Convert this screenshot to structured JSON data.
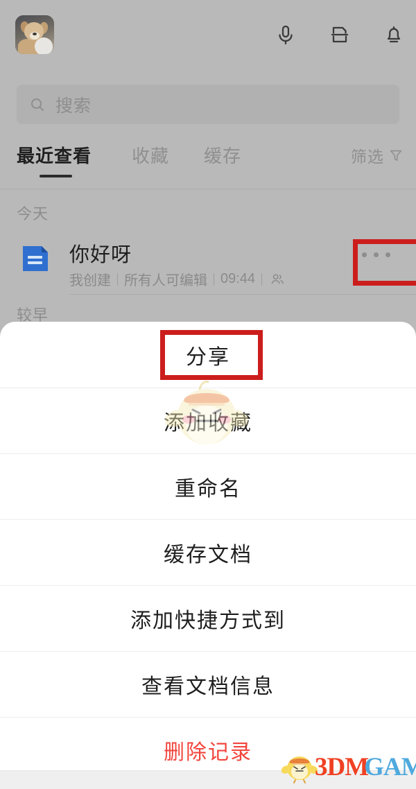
{
  "topbar": {
    "avatar_alt": "用户头像",
    "icons": [
      {
        "name": "microphone-icon",
        "label": "语音"
      },
      {
        "name": "scan-icon",
        "label": "扫一扫"
      },
      {
        "name": "bell-icon",
        "label": "通知"
      }
    ]
  },
  "search": {
    "placeholder": "搜索",
    "value": "",
    "icon": "search-icon"
  },
  "tabs": [
    {
      "label": "最近查看",
      "active": true
    },
    {
      "label": "收藏",
      "active": false
    },
    {
      "label": "缓存",
      "active": false
    }
  ],
  "filter": {
    "label": "筛选",
    "icon": "funnel-icon"
  },
  "sections": {
    "today": "今天",
    "earlier": "较早"
  },
  "document": {
    "title": "你好呀",
    "owner": "我创建",
    "permission": "所有人可编辑",
    "time": "09:44",
    "collaborators_icon": "group-icon",
    "more_label": "更多",
    "file_icon": "doc-icon"
  },
  "action_sheet": {
    "items": [
      {
        "label": "分享",
        "danger": false,
        "highlighted": true
      },
      {
        "label": "添加收藏",
        "danger": false,
        "highlighted": false
      },
      {
        "label": "重命名",
        "danger": false,
        "highlighted": false
      },
      {
        "label": "缓存文档",
        "danger": false,
        "highlighted": false
      },
      {
        "label": "添加快捷方式到",
        "danger": false,
        "highlighted": false
      },
      {
        "label": "查看文档信息",
        "danger": false,
        "highlighted": false
      },
      {
        "label": "删除记录",
        "danger": true,
        "highlighted": false
      }
    ]
  },
  "watermark": {
    "brand_first": "3DM",
    "brand_second": "GAME",
    "mascot": "chick-mascot"
  },
  "colors": {
    "backdrop": "#b9b9b9",
    "sheet": "#ffffff",
    "danger": "#f2453d",
    "annotation": "#cc1d1d",
    "doc_icon": "#2f6fd0",
    "brand_red": "#ef4123",
    "brand_blue": "#4fa9dd"
  }
}
